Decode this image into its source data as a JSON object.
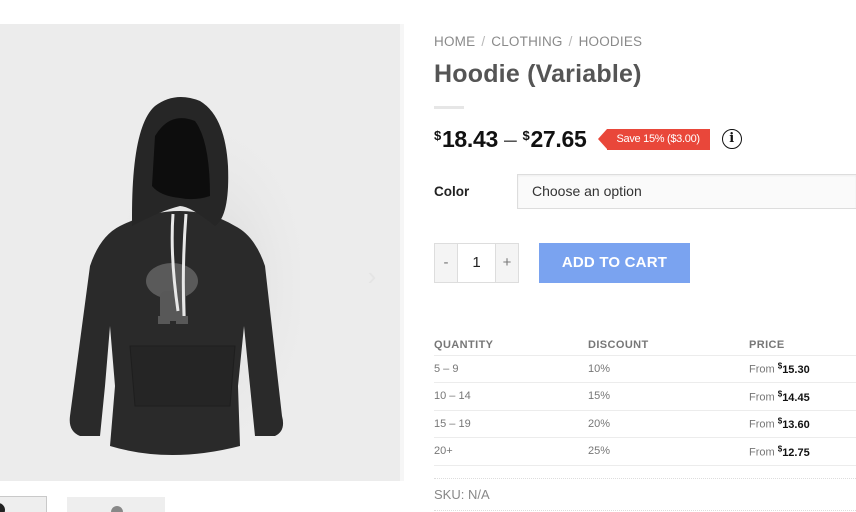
{
  "breadcrumb": [
    {
      "label": "HOME"
    },
    {
      "label": "CLOTHING"
    },
    {
      "label": "HOODIES"
    }
  ],
  "breadcrumb_separator": "/",
  "product": {
    "title": "Hoodie (Variable)",
    "price_min_currency": "$",
    "price_min": "18.43",
    "price_range_dash": "–",
    "price_max_currency": "$",
    "price_max": "27.65",
    "save_badge": "Save 15% ($3.00)",
    "info_icon_glyph": "i",
    "sku_label": "SKU:",
    "sku_value": "N/A"
  },
  "variation": {
    "label": "Color",
    "selected": "Choose an option"
  },
  "cart": {
    "minus_label": "-",
    "quantity": "1",
    "plus_label": "+",
    "add_to_cart_label": "ADD TO CART"
  },
  "gallery": {
    "next_arrow_glyph": "›"
  },
  "discount_table": {
    "headers": [
      "QUANTITY",
      "DISCOUNT",
      "PRICE"
    ],
    "rows": [
      {
        "quantity": "5 – 9",
        "discount": "10%",
        "from": "From",
        "currency": "$",
        "price": "15.30"
      },
      {
        "quantity": "10 – 14",
        "discount": "15%",
        "from": "From",
        "currency": "$",
        "price": "14.45"
      },
      {
        "quantity": "15 – 19",
        "discount": "20%",
        "from": "From",
        "currency": "$",
        "price": "13.60"
      },
      {
        "quantity": "20+",
        "discount": "25%",
        "from": "From",
        "currency": "$",
        "price": "12.75"
      }
    ]
  },
  "colors": {
    "accent_button": "#7aa3f0",
    "save_badge": "#e9473a",
    "image_background": "#ececec"
  }
}
